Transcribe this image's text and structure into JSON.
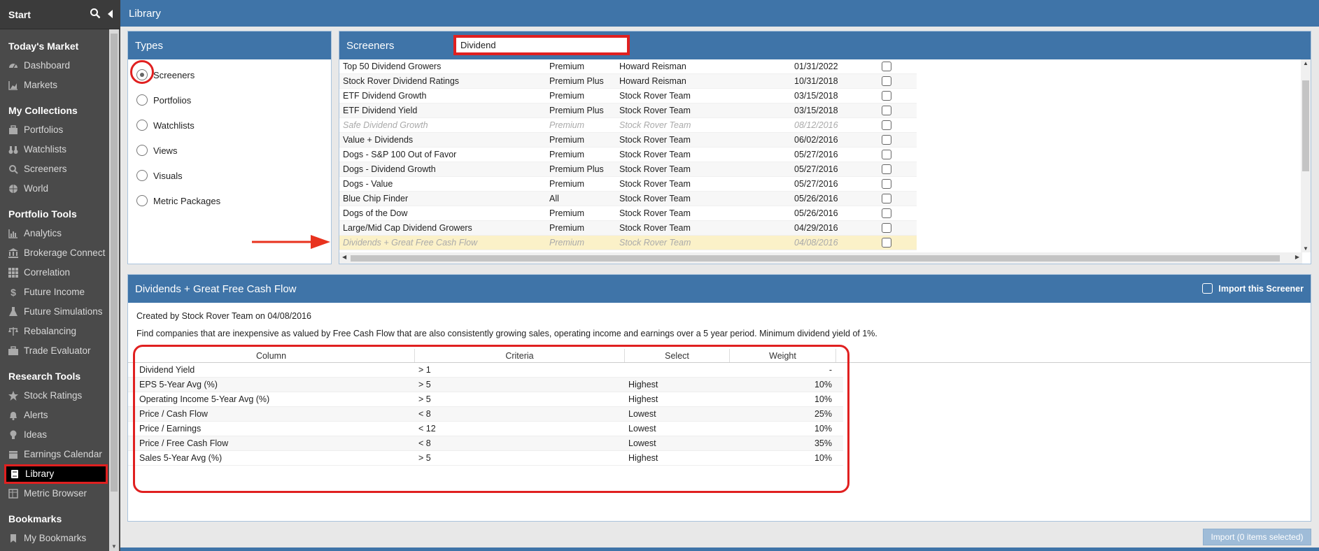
{
  "sidebar": {
    "start_label": "Start",
    "sections": [
      {
        "title": "Today's Market",
        "items": [
          {
            "label": "Dashboard",
            "icon": "dashboard-icon"
          },
          {
            "label": "Markets",
            "icon": "area-chart-icon"
          }
        ]
      },
      {
        "title": "My Collections",
        "items": [
          {
            "label": "Portfolios",
            "icon": "portfolio-icon"
          },
          {
            "label": "Watchlists",
            "icon": "binoculars-icon"
          },
          {
            "label": "Screeners",
            "icon": "search-icon"
          },
          {
            "label": "World",
            "icon": "globe-icon"
          }
        ]
      },
      {
        "title": "Portfolio Tools",
        "items": [
          {
            "label": "Analytics",
            "icon": "bar-chart-icon"
          },
          {
            "label": "Brokerage Connect",
            "icon": "bank-icon"
          },
          {
            "label": "Correlation",
            "icon": "grid-icon"
          },
          {
            "label": "Future Income",
            "icon": "dollar-icon"
          },
          {
            "label": "Future Simulations",
            "icon": "flask-icon"
          },
          {
            "label": "Rebalancing",
            "icon": "scale-icon"
          },
          {
            "label": "Trade Evaluator",
            "icon": "briefcase-icon"
          }
        ]
      },
      {
        "title": "Research Tools",
        "items": [
          {
            "label": "Stock Ratings",
            "icon": "star-icon"
          },
          {
            "label": "Alerts",
            "icon": "bell-icon"
          },
          {
            "label": "Ideas",
            "icon": "lightbulb-icon"
          },
          {
            "label": "Earnings Calendar",
            "icon": "calendar-icon"
          },
          {
            "label": "Library",
            "icon": "book-icon",
            "active": true
          },
          {
            "label": "Metric Browser",
            "icon": "table-icon"
          }
        ]
      },
      {
        "title": "Bookmarks",
        "items": [
          {
            "label": "My Bookmarks",
            "icon": "bookmark-icon"
          }
        ]
      }
    ]
  },
  "header": {
    "title": "Library"
  },
  "types": {
    "title": "Types",
    "options": [
      {
        "label": "Screeners",
        "selected": true
      },
      {
        "label": "Portfolios",
        "selected": false
      },
      {
        "label": "Watchlists",
        "selected": false
      },
      {
        "label": "Views",
        "selected": false
      },
      {
        "label": "Visuals",
        "selected": false
      },
      {
        "label": "Metric Packages",
        "selected": false
      }
    ]
  },
  "screeners": {
    "title": "Screeners",
    "search_value": "Dividend",
    "rows": [
      {
        "name": "Top 50 Dividend Growers",
        "level": "Premium",
        "author": "Howard Reisman",
        "date": "01/31/2022"
      },
      {
        "name": "Stock Rover Dividend Ratings",
        "level": "Premium Plus",
        "author": "Howard Reisman",
        "date": "10/31/2018"
      },
      {
        "name": "ETF Dividend Growth",
        "level": "Premium",
        "author": "Stock Rover Team",
        "date": "03/15/2018"
      },
      {
        "name": "ETF Dividend Yield",
        "level": "Premium Plus",
        "author": "Stock Rover Team",
        "date": "03/15/2018"
      },
      {
        "name": "Safe Dividend Growth",
        "level": "Premium",
        "author": "Stock Rover Team",
        "date": "08/12/2016",
        "dim": true
      },
      {
        "name": "Value + Dividends",
        "level": "Premium",
        "author": "Stock Rover Team",
        "date": "06/02/2016"
      },
      {
        "name": "Dogs - S&P 100 Out of Favor",
        "level": "Premium",
        "author": "Stock Rover Team",
        "date": "05/27/2016"
      },
      {
        "name": "Dogs - Dividend Growth",
        "level": "Premium Plus",
        "author": "Stock Rover Team",
        "date": "05/27/2016"
      },
      {
        "name": "Dogs - Value",
        "level": "Premium",
        "author": "Stock Rover Team",
        "date": "05/27/2016"
      },
      {
        "name": "Blue Chip Finder",
        "level": "All",
        "author": "Stock Rover Team",
        "date": "05/26/2016"
      },
      {
        "name": "Dogs of the Dow",
        "level": "Premium",
        "author": "Stock Rover Team",
        "date": "05/26/2016"
      },
      {
        "name": "Large/Mid Cap Dividend Growers",
        "level": "Premium",
        "author": "Stock Rover Team",
        "date": "04/29/2016"
      },
      {
        "name": "Dividends + Great Free Cash Flow",
        "level": "Premium",
        "author": "Stock Rover Team",
        "date": "04/08/2016",
        "dim": true,
        "selected": true
      }
    ]
  },
  "details": {
    "title": "Dividends + Great Free Cash Flow",
    "import_label": "Import this Screener",
    "created": "Created by Stock Rover Team on 04/08/2016",
    "description": "Find companies that are inexpensive as valued by Free Cash Flow that are also consistently growing sales, operating income and earnings over a 5 year period. Minimum dividend yield of 1%.",
    "columns": [
      "Column",
      "Criteria",
      "Select",
      "Weight"
    ],
    "criteria": [
      {
        "column": "Dividend Yield",
        "criteria": "> 1",
        "select": "",
        "weight": "-"
      },
      {
        "column": "EPS 5-Year Avg (%)",
        "criteria": "> 5",
        "select": "Highest",
        "weight": "10%"
      },
      {
        "column": "Operating Income 5-Year Avg (%)",
        "criteria": "> 5",
        "select": "Highest",
        "weight": "10%"
      },
      {
        "column": "Price / Cash Flow",
        "criteria": "< 8",
        "select": "Lowest",
        "weight": "25%"
      },
      {
        "column": "Price / Earnings",
        "criteria": "< 12",
        "select": "Lowest",
        "weight": "10%"
      },
      {
        "column": "Price / Free Cash Flow",
        "criteria": "< 8",
        "select": "Lowest",
        "weight": "35%"
      },
      {
        "column": "Sales 5-Year Avg (%)",
        "criteria": "> 5",
        "select": "Highest",
        "weight": "10%"
      }
    ]
  },
  "footer": {
    "import_button": "Import (0 items selected)"
  },
  "colors": {
    "header_blue": "#3f74a8",
    "highlight_red": "#e02020",
    "sidebar_bg": "#4a4a4a",
    "selected_row": "#fbf1c8"
  }
}
